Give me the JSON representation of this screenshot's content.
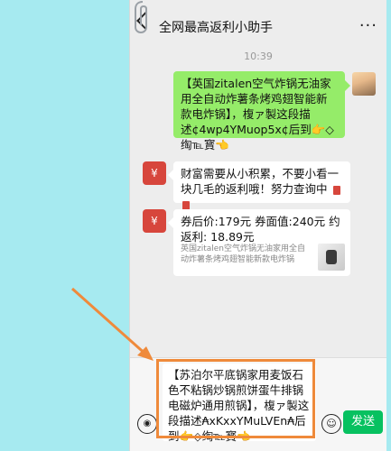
{
  "header": {
    "title": "全网最高返利小助手",
    "more": "···"
  },
  "time": "10:39",
  "messages": {
    "user_product_text": "【英国zitalen空气炸锅无油家用全自动炸薯条烤鸡翅智能新款电炸锅】，椱ァ製这段描述¢4wp4YMuop5x¢后到👉◇绹℡寳👈",
    "bot_tip": "财富需要从小积累，不要小看一块几毛的返利哦！努力查询中",
    "bot_price_line1": "券后价:179元 券面值:240元 约返利: 18.89元",
    "bot_card_sub": "英国zitalen空气炸锅无油家用全自动炸薯条烤鸡翅智能新款电炸锅"
  },
  "input": {
    "text": "【苏泊尔平底锅家用麦饭石色不粘锅炒锅煎饼蛋牛排锅电磁炉通用煎锅】，椱ァ製这段描述₳xKxxYMuLVEn₳后到👉◇绹℡寳👈"
  },
  "buttons": {
    "send": "发送"
  },
  "icons": {
    "voice": "voice-icon",
    "emoji": "emoji-icon",
    "back": "back-icon",
    "bot_avatar": "¥"
  },
  "colors": {
    "green_bubble": "#95ec69",
    "send": "#07c160",
    "annotation": "#ef8a3b",
    "background": "#a6eaf0"
  }
}
